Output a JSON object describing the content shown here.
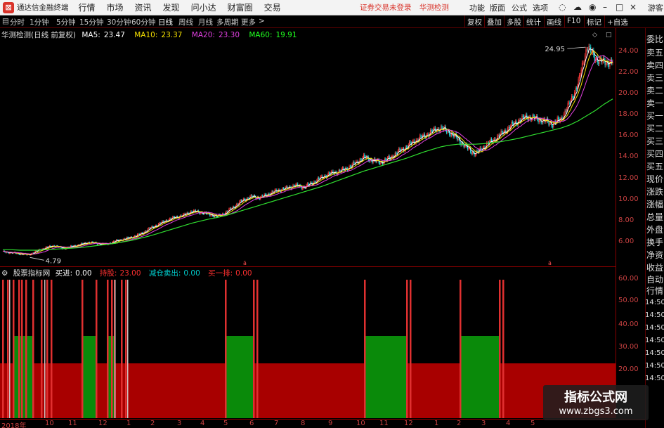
{
  "titlebar": {
    "app_title": "通达信金融终端",
    "menu": [
      "行情",
      "市场",
      "资讯",
      "发现",
      "问小达",
      "财富圈",
      "交易"
    ],
    "notice": "证券交易未登录",
    "stock_note": "华测检测",
    "tools": [
      "功能",
      "版面",
      "公式",
      "选项"
    ],
    "guest": "游客"
  },
  "toolbar": {
    "periods": [
      "分时",
      "1分钟",
      "5分钟",
      "15分钟",
      "30分钟",
      "60分钟",
      "日线",
      "周线",
      "月线",
      "多周期",
      "更多"
    ],
    "active_period": "日线",
    "right_buttons": [
      "复权",
      "叠加",
      "多股",
      "统计",
      "画线",
      "F10",
      "标记",
      "+自选"
    ]
  },
  "main_chart": {
    "stock_label": "华测检测(日线 前复权)",
    "ma": [
      {
        "label": "MA5:",
        "value": "23.47",
        "color": "#ffffff"
      },
      {
        "label": "MA10:",
        "value": "23.37",
        "color": "#f5e000"
      },
      {
        "label": "MA20:",
        "value": "23.30",
        "color": "#e040e0"
      },
      {
        "label": "MA60:",
        "value": "19.91",
        "color": "#20ff20"
      }
    ],
    "high_label": "24.95",
    "low_label": "4.79",
    "y_ticks": [
      "24.00",
      "22.00",
      "20.00",
      "18.00",
      "16.00",
      "14.00",
      "12.00",
      "10.00",
      "8.00",
      "6.00"
    ]
  },
  "sub_chart": {
    "name": "股票指标网",
    "items": [
      {
        "label": "买进:",
        "value": "0.00",
        "color": "#ffffff"
      },
      {
        "label": "持股:",
        "value": "23.00",
        "color": "#ff3030"
      },
      {
        "label": "减仓卖出:",
        "value": "0.00",
        "color": "#00d0d0"
      },
      {
        "label": "买一排:",
        "value": "0.00",
        "color": "#ff3030"
      }
    ],
    "y_ticks": [
      "60.00",
      "50.00",
      "40.00",
      "30.00",
      "20.00"
    ]
  },
  "side_panel": {
    "items": [
      "委比",
      "卖五",
      "卖四",
      "卖三",
      "卖二",
      "卖一",
      "买一",
      "买二",
      "买三",
      "买四",
      "买五",
      "现价",
      "涨跌",
      "涨幅",
      "总量",
      "外盘",
      "换手",
      "净资",
      "收益",
      "自动",
      "行情"
    ],
    "times": [
      "14:50",
      "14:50",
      "14:50",
      "14:50",
      "14:50",
      "14:50",
      "14:50"
    ]
  },
  "date_axis": [
    "2018年",
    "10",
    "11",
    "12",
    "1",
    "2",
    "3",
    "4",
    "5",
    "6",
    "7",
    "8",
    "9",
    "10",
    "11",
    "12",
    "1",
    "2",
    "3",
    "4",
    "5"
  ],
  "watermark": {
    "title": "指标公式网",
    "url": "www.zbgs3.com"
  },
  "chart_data": {
    "type": "candlestick",
    "y_range": [
      4.0,
      25.5
    ],
    "close_series": [
      5.2,
      5.1,
      5.0,
      4.9,
      5.3,
      5.6,
      5.8,
      5.5,
      5.7,
      5.9,
      6.1,
      6.0,
      5.9,
      6.2,
      6.4,
      6.6,
      6.9,
      7.4,
      7.8,
      8.2,
      8.5,
      8.7,
      9.1,
      9.0,
      8.8,
      8.6,
      9.0,
      9.6,
      10.2,
      10.5,
      10.4,
      10.8,
      11.1,
      11.3,
      11.6,
      11.4,
      11.8,
      12.3,
      12.7,
      12.9,
      13.2,
      13.7,
      14.3,
      14.0,
      13.8,
      14.2,
      14.8,
      15.3,
      15.9,
      16.3,
      16.8,
      17.1,
      16.7,
      16.0,
      15.2,
      14.6,
      15.3,
      15.9,
      16.5,
      17.2,
      17.8,
      18.2,
      18.0,
      17.8,
      17.5,
      18.0,
      19.5,
      21.5,
      24.95,
      23.8,
      23.4,
      23.5
    ],
    "ma60_series": [
      5.4,
      5.4,
      5.35,
      5.35,
      5.35,
      5.4,
      5.45,
      5.5,
      5.55,
      5.6,
      5.7,
      5.8,
      5.9,
      6.0,
      6.15,
      6.3,
      6.5,
      6.7,
      6.95,
      7.2,
      7.45,
      7.7,
      7.95,
      8.15,
      8.35,
      8.5,
      8.7,
      8.95,
      9.2,
      9.45,
      9.7,
      9.95,
      10.2,
      10.45,
      10.7,
      10.95,
      11.2,
      11.45,
      11.75,
      12.05,
      12.35,
      12.65,
      12.95,
      13.2,
      13.45,
      13.7,
      13.95,
      14.2,
      14.5,
      14.8,
      15.05,
      15.3,
      15.45,
      15.55,
      15.55,
      15.55,
      15.6,
      15.7,
      15.8,
      15.95,
      16.1,
      16.3,
      16.5,
      16.7,
      16.9,
      17.1,
      17.4,
      17.8,
      18.3,
      18.8,
      19.4,
      19.91
    ]
  }
}
